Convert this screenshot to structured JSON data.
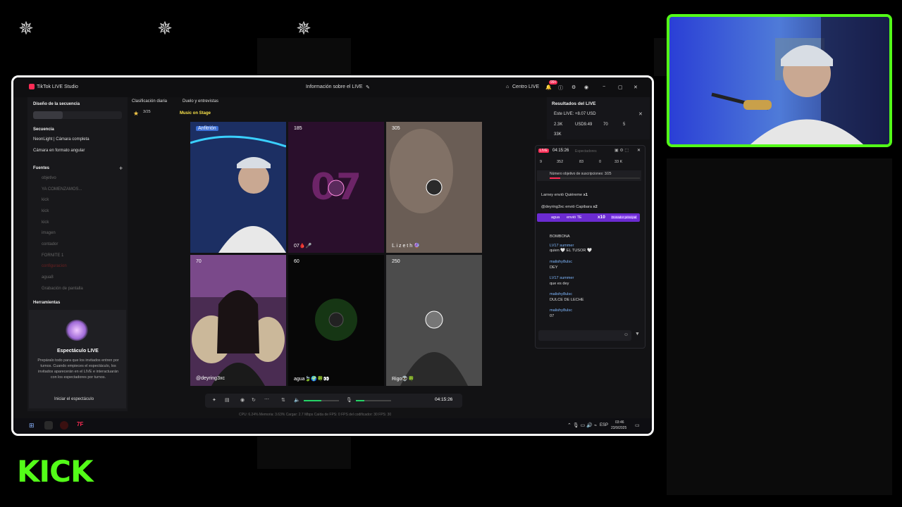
{
  "overlay": {
    "kick_logo": "KICK",
    "star_icon": "star-logo-icon"
  },
  "titlebar": {
    "app_name": "TikTok LIVE Studio",
    "center_title": "Información sobre el LIVE",
    "centro_live": "Centro LIVE",
    "badge": "99+"
  },
  "topbar": {
    "clasificacion": "Clasificación diaria",
    "duelo": "Duelo y entrevistas",
    "progress": "3/25",
    "music": "Music on Stage"
  },
  "sidebar": {
    "diseno": "Diseño de la secuencia",
    "secuencia": "Secuencia",
    "seq_items": [
      "NeonLight | Cámara completa",
      "Cámara en formato angular"
    ],
    "fuentes": "Fuentes",
    "fuentes_items": [
      "objetivo",
      "YA COMENZAMOS...",
      "kick",
      "kick",
      "kick",
      "imagen",
      "contador",
      "FORNITE 1",
      "configuracion",
      "agua8",
      "Grabación de pantalla"
    ],
    "herramientas": "Herramientas",
    "espectaculo_title": "Espectáculo LIVE",
    "espectaculo_desc": "Prepáralo todo para que los invitados entren por turnos. Cuando empieces el espectáculo, los invitados aparecerán en el LIVE e interactuarán con los espectadores por turnos.",
    "iniciar_btn": "Iniciar el espectáculo"
  },
  "tiles": [
    {
      "top_label": "Anfitrión",
      "bottom_label": ""
    },
    {
      "top_label": "185",
      "bottom_label": "07🩸🎤"
    },
    {
      "top_label": "305",
      "bottom_label": "𝕃 i z e t h 🔮"
    },
    {
      "top_label": "70",
      "bottom_label": "@deyring3xc"
    },
    {
      "top_label": "60",
      "bottom_label": "agua🍃🌍🍀👀"
    },
    {
      "top_label": "250",
      "bottom_label": "Rigo👽🍀"
    }
  ],
  "controls": {
    "timer": "04:15:26"
  },
  "stats": {
    "text": "CPU: 6.24%     Memoria: 3.63%     Cargar: 2.7 Mbps     Caída de FPS: 0     FPS del codificador: 30     FPS: 30"
  },
  "results": {
    "title": "Resultados del LIVE",
    "este_live": "Este LIVE: +8.07 USD",
    "stat_1": "2.3K",
    "stat_usd": "USD9.49",
    "stat_3": "70",
    "stat_4": "5",
    "stat_5": "33K"
  },
  "chat": {
    "timer": "04:15:26",
    "tab_label": "Espectadores",
    "count_1": "9",
    "count_2": "352",
    "count_3": "83",
    "count_4": "0",
    "count_5": "33 K",
    "goal": "Número objetivo de suscripciones: 3/25",
    "gift_1_user": "Larney",
    "gift_1_text": "envió Quiéreme",
    "gift_1_count": "x1",
    "gift_2_user": "@deyring3xc",
    "gift_2_text": "envió Capibara",
    "gift_2_count": "x2",
    "gift_3_user": "agua",
    "gift_3_text": "envió TE",
    "gift_3_count": "x10",
    "gift_3_badge": "Donador principal",
    "messages": [
      {
        "user": "",
        "text": "BOMBONA"
      },
      {
        "user": "LV17 summer",
        "text": "quien 🤍 EL TUSOR 🤍"
      },
      {
        "user": "malishy8ulsc",
        "text": "DEY"
      },
      {
        "user": "LV17 summer",
        "text": "que es dey"
      },
      {
        "user": "malishy8ulsc",
        "text": "DULCE DE LECHE"
      },
      {
        "user": "malishy8ulsc",
        "text": "07"
      }
    ]
  },
  "taskbar": {
    "lang": "ESP",
    "time": "03:46",
    "date": "23/9/2025"
  },
  "colors": {
    "kick_green": "#53fc18",
    "live_red": "#fe2c55",
    "progress_green": "#25d366",
    "gift_purple": "#6b2bd1"
  }
}
